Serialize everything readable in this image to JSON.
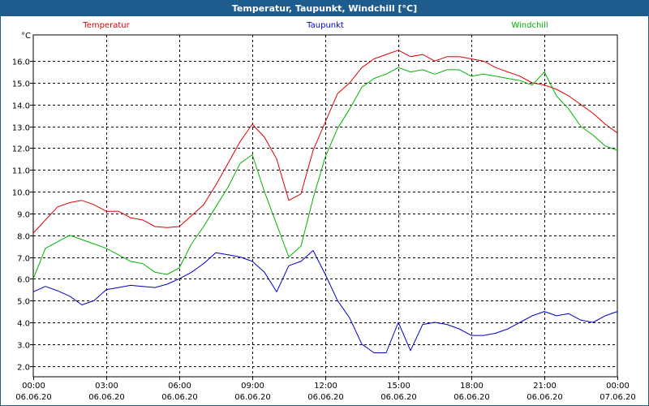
{
  "window": {
    "title": "Temperatur, Taupunkt, Windchill [°C]"
  },
  "chart_data": {
    "type": "line",
    "title": "Temperatur, Taupunkt, Windchill [°C]",
    "y_unit": "°C",
    "ylim": [
      1.5,
      17.2
    ],
    "grid": true,
    "legend": "top",
    "x_tick_labels": [
      {
        "time": "00:00",
        "date": "06.06.20"
      },
      {
        "time": "03:00",
        "date": "06.06.20"
      },
      {
        "time": "06:00",
        "date": "06.06.20"
      },
      {
        "time": "09:00",
        "date": "06.06.20"
      },
      {
        "time": "12:00",
        "date": "06.06.20"
      },
      {
        "time": "15:00",
        "date": "06.06.20"
      },
      {
        "time": "18:00",
        "date": "06.06.20"
      },
      {
        "time": "21:00",
        "date": "06.06.20"
      },
      {
        "time": "00:00",
        "date": "07.06.20"
      }
    ],
    "y_ticks": [
      "2.0",
      "3.0",
      "4.0",
      "5.0",
      "6.0",
      "7.0",
      "8.0",
      "9.0",
      "10.0",
      "11.0",
      "12.0",
      "13.0",
      "14.0",
      "15.0",
      "16.0"
    ],
    "x": [
      "00:00",
      "00:30",
      "01:00",
      "01:30",
      "02:00",
      "02:30",
      "03:00",
      "03:30",
      "04:00",
      "04:30",
      "05:00",
      "05:30",
      "06:00",
      "06:30",
      "07:00",
      "07:30",
      "08:00",
      "08:30",
      "09:00",
      "09:30",
      "10:00",
      "10:30",
      "11:00",
      "11:30",
      "12:00",
      "12:30",
      "13:00",
      "13:30",
      "14:00",
      "14:30",
      "15:00",
      "15:30",
      "16:00",
      "16:30",
      "17:00",
      "17:30",
      "18:00",
      "18:30",
      "19:00",
      "19:30",
      "20:00",
      "20:30",
      "21:00",
      "21:30",
      "22:00",
      "22:30",
      "23:00",
      "23:30",
      "24:00"
    ],
    "series": [
      {
        "name": "Temperatur",
        "color": "#e00000",
        "values": [
          8.1,
          8.7,
          9.3,
          9.5,
          9.6,
          9.4,
          9.1,
          9.1,
          8.8,
          8.7,
          8.4,
          8.35,
          8.4,
          8.9,
          9.4,
          10.3,
          11.3,
          12.3,
          13.1,
          12.5,
          11.5,
          9.6,
          9.9,
          11.9,
          13.2,
          14.5,
          15.0,
          15.7,
          16.1,
          16.3,
          16.5,
          16.2,
          16.3,
          16.0,
          16.2,
          16.2,
          16.1,
          16.0,
          15.7,
          15.5,
          15.3,
          15.0,
          14.9,
          14.7,
          14.4,
          14.0,
          13.6,
          13.1,
          12.7
        ]
      },
      {
        "name": "Taupunkt",
        "color": "#0000cc",
        "values": [
          5.4,
          5.65,
          5.45,
          5.2,
          4.8,
          5.0,
          5.5,
          5.6,
          5.7,
          5.65,
          5.6,
          5.75,
          6.0,
          6.3,
          6.7,
          7.2,
          7.1,
          7.0,
          6.8,
          6.3,
          5.4,
          6.6,
          6.8,
          7.3,
          6.2,
          5.0,
          4.2,
          3.0,
          2.6,
          2.6,
          4.0,
          2.7,
          3.9,
          4.0,
          3.9,
          3.7,
          3.4,
          3.4,
          3.5,
          3.7,
          4.0,
          4.3,
          4.5,
          4.3,
          4.4,
          4.1,
          4.0,
          4.3,
          4.5
        ]
      },
      {
        "name": "Windchill",
        "color": "#00b400",
        "values": [
          6.0,
          7.4,
          7.7,
          8.0,
          7.8,
          7.6,
          7.4,
          7.1,
          6.8,
          6.7,
          6.3,
          6.2,
          6.5,
          7.6,
          8.4,
          9.3,
          10.2,
          11.3,
          11.7,
          10.0,
          8.5,
          7.0,
          7.5,
          9.7,
          11.6,
          12.9,
          13.8,
          14.8,
          15.2,
          15.4,
          15.7,
          15.5,
          15.6,
          15.4,
          15.6,
          15.6,
          15.3,
          15.4,
          15.3,
          15.2,
          15.1,
          14.9,
          15.5,
          14.4,
          13.8,
          13.0,
          12.6,
          12.1,
          11.9
        ]
      }
    ]
  }
}
